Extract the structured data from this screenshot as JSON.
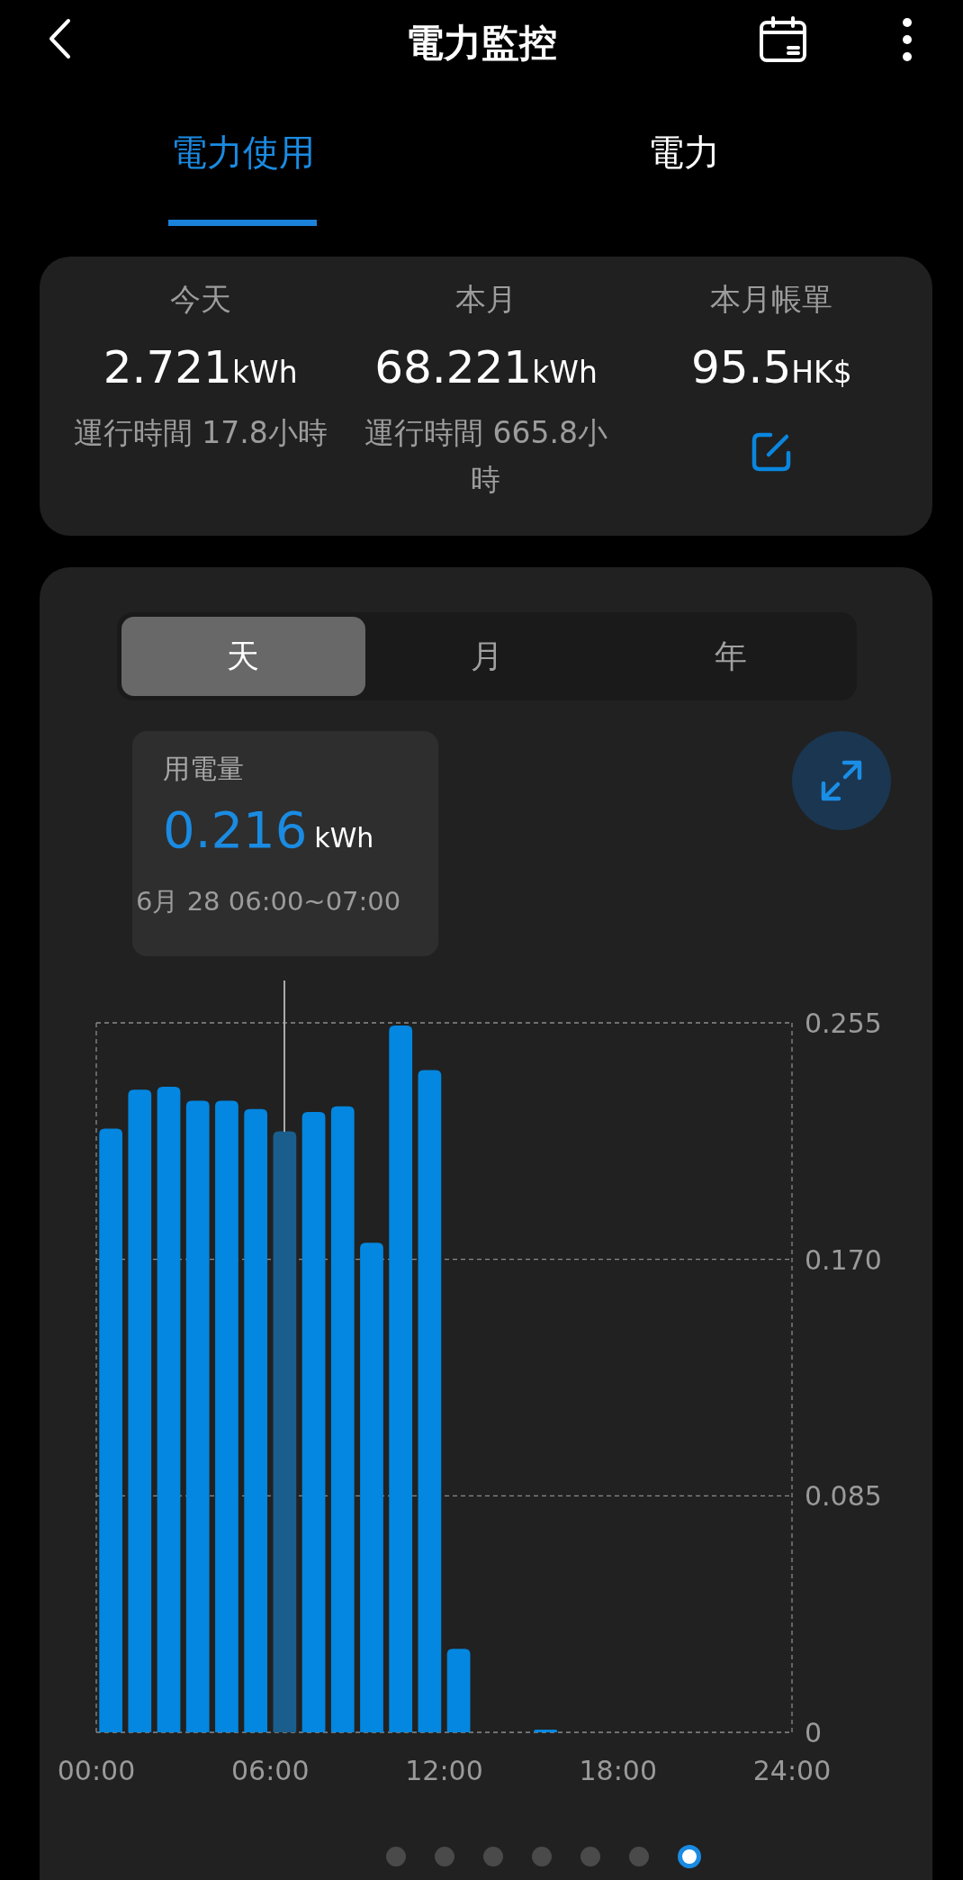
{
  "header": {
    "title": "電力監控"
  },
  "tabs": [
    {
      "label": "電力使用",
      "selected": true
    },
    {
      "label": "電力",
      "selected": false
    }
  ],
  "summary": [
    {
      "kind": "usage",
      "label": "今天",
      "value": "2.721",
      "unit": "kWh",
      "runtime": "運行時間 17.8小時"
    },
    {
      "kind": "usage",
      "label": "本月",
      "value": "68.221",
      "unit": "kWh",
      "runtime": "運行時間 665.8小時"
    },
    {
      "kind": "bill",
      "label": "本月帳單",
      "value": "95.5",
      "unit": "HK$"
    }
  ],
  "chart_panel": {
    "periods": [
      {
        "label": "天",
        "selected": true
      },
      {
        "label": "月",
        "selected": false
      },
      {
        "label": "年",
        "selected": false
      }
    ],
    "tooltip": {
      "title": "用電量",
      "value": "0.216",
      "unit": "kWh",
      "time": "6月 28 06:00~07:00"
    },
    "chart_data": {
      "type": "bar",
      "x": [
        0.5,
        1.5,
        2.5,
        3.5,
        4.5,
        5.5,
        6.5,
        7.5,
        8.5,
        9.5,
        10.5,
        11.5,
        12.5,
        13.5,
        14.5,
        15.5
      ],
      "series": [
        {
          "color": "#0387e0",
          "values": [
            0.217,
            0.231,
            0.232,
            0.227,
            0.227,
            0.224,
            null,
            0.223,
            0.225,
            0.176,
            0.254,
            0.238,
            0.03,
            null,
            null,
            0.001
          ]
        },
        {
          "color": "#1a5e8e",
          "values": [
            null,
            null,
            null,
            null,
            null,
            null,
            0.216,
            null,
            null,
            null,
            null,
            null,
            null,
            null,
            null,
            null
          ]
        }
      ],
      "xlim": [
        0,
        24
      ],
      "ylim": [
        0,
        0.255
      ],
      "xticks": [
        {
          "value": 0,
          "label": "00:00"
        },
        {
          "value": 6,
          "label": "06:00"
        },
        {
          "value": 12,
          "label": "12:00"
        },
        {
          "value": 18,
          "label": "18:00"
        },
        {
          "value": 24,
          "label": "24:00"
        }
      ],
      "yticks": [
        {
          "value": 0,
          "label": "0"
        },
        {
          "value": 0.085,
          "label": "0.085"
        },
        {
          "value": 0.17,
          "label": "0.170"
        },
        {
          "value": 0.255,
          "label": "0.255"
        }
      ]
    },
    "page_dots": [
      {
        "selected": false
      },
      {
        "selected": false
      },
      {
        "selected": false
      },
      {
        "selected": false
      },
      {
        "selected": false
      },
      {
        "selected": false
      },
      {
        "selected": true
      }
    ]
  }
}
